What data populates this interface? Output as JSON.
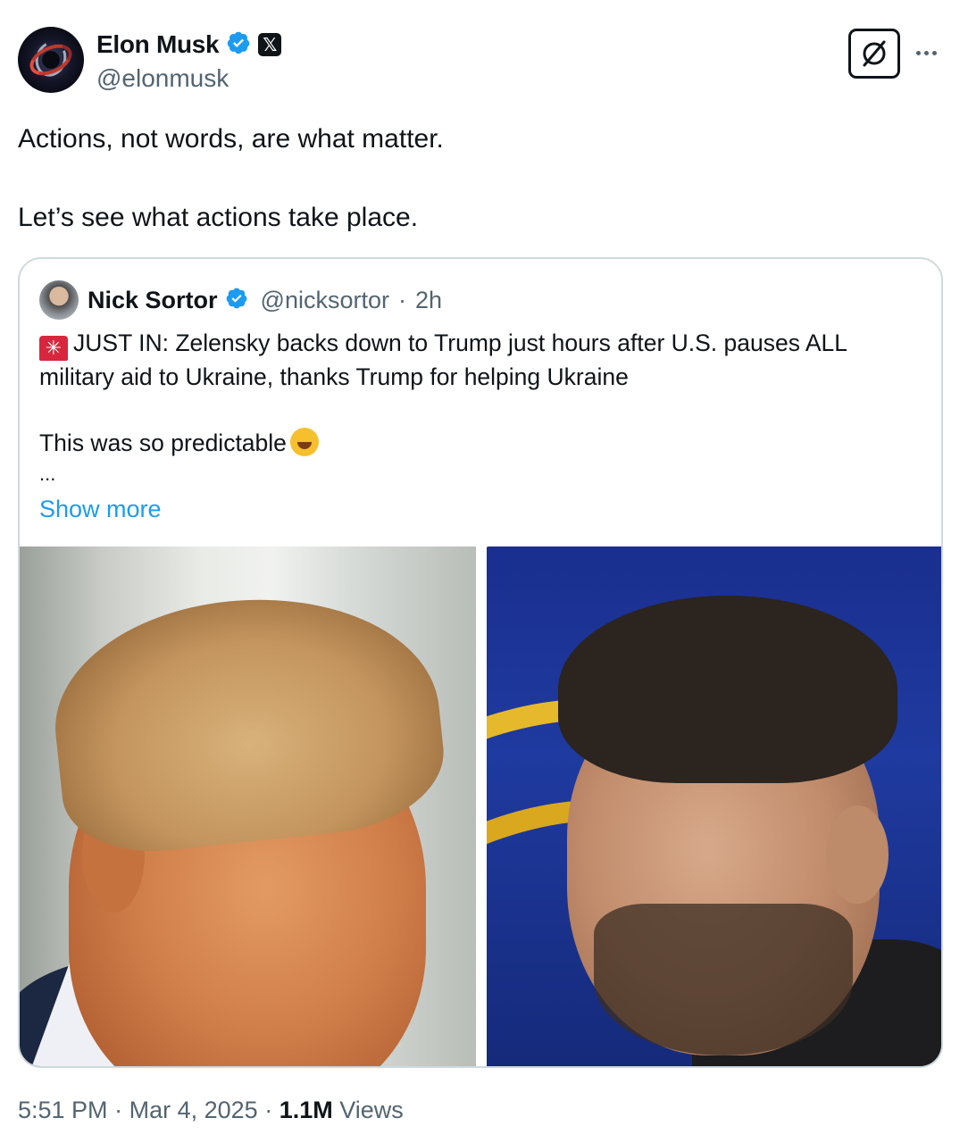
{
  "author": {
    "display_name": "Elon Musk",
    "handle": "@elonmusk",
    "verified_icon": "verified-badge-icon",
    "affiliate_icon": "x-logo-icon"
  },
  "header_actions": {
    "grok_icon": "grok-icon",
    "more_icon": "more-horizontal-icon"
  },
  "tweet": {
    "paragraphs": [
      "Actions, not words, are what matter.",
      "Let’s see what actions take place."
    ]
  },
  "quoted_tweet": {
    "display_name": "Nick Sortor",
    "handle": "@nicksortor",
    "separator": "·",
    "time_ago": "2h",
    "line1": "JUST IN: Zelensky backs down to Trump just hours after U.S. pauses ALL military aid to Ukraine, thanks Trump for helping Ukraine",
    "line2": "This was so predictable",
    "ellipsis": "...",
    "show_more": "Show more",
    "siren_icon": "siren-emoji-icon",
    "laugh_icon": "rolling-laughing-emoji-icon"
  },
  "footer": {
    "time": "5:51 PM",
    "sep1": "·",
    "date": "Mar 4, 2025",
    "sep2": "·",
    "views_count": "1.1M",
    "views_label": "Views"
  },
  "colors": {
    "accent": "#1d9bf0",
    "secondary_text": "#536471",
    "border": "#cfd9de"
  }
}
